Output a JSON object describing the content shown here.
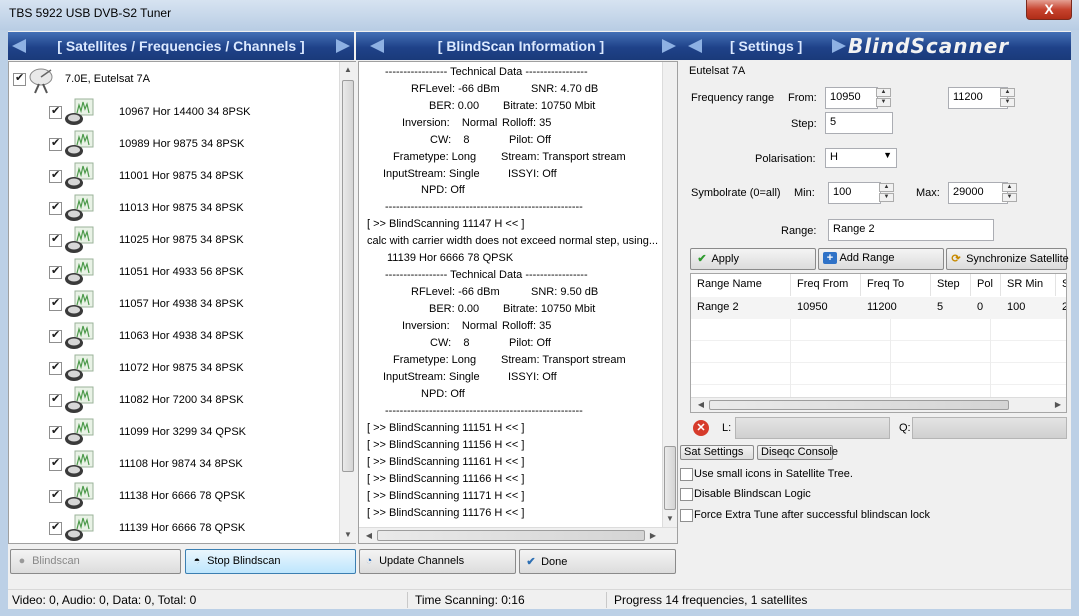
{
  "window": {
    "title": "TBS 5922 USB DVB-S2 Tuner",
    "close": "X"
  },
  "headers": {
    "satellites": "[ Satellites / Frequencies / Channels ]",
    "blindscan": "[ BlindScan Information ]",
    "settings": "[ Settings ]",
    "logo": "BlindScanner"
  },
  "tree": {
    "satellite": "7.0E, Eutelsat 7A",
    "items": [
      "10967 Hor 14400 34 8PSK",
      "10989 Hor 9875 34 8PSK",
      "11001 Hor 9875 34 8PSK",
      "11013 Hor 9875 34 8PSK",
      "11025 Hor 9875 34 8PSK",
      "11051 Hor 4933 56 8PSK",
      "11057 Hor 4938 34 8PSK",
      "11063 Hor 4938 34 8PSK",
      "11072 Hor 9875 34 8PSK",
      "11082 Hor 7200 34 8PSK",
      "11099 Hor 3299 34 QPSK",
      "11108 Hor 9874 34 8PSK",
      "11138 Hor 6666 78 QPSK",
      "11139 Hor 6666 78 QPSK"
    ]
  },
  "log": {
    "tech_header": "----------------- Technical Data -----------------",
    "block1": {
      "rflevel": "RFLevel: -66 dBm",
      "snr": "SNR: 4.70 dB",
      "ber": "BER: 0.00",
      "bitrate": "Bitrate: 10750 Mbit",
      "inversion": "Inversion:    Normal",
      "rolloff": "Rolloff: 35",
      "cw": "CW:    8",
      "pilot": "Pilot: Off",
      "frametype": "Frametype: Long",
      "stream": "Stream: Transport stream",
      "inputstream": "InputStream: Single",
      "issyi": "ISSYI: Off",
      "npd": "NPD: Off"
    },
    "separator": "------------------------------------------------------",
    "scan_11147": "[ >> BlindScanning 11147 H << ]",
    "calc_msg": "calc with carrier width does not exceed normal step, using...",
    "found": "11139 Hor 6666 78 QPSK",
    "block2": {
      "rflevel": "RFLevel: -66 dBm",
      "snr": "SNR: 9.50 dB",
      "ber": "BER: 0.00",
      "bitrate": "Bitrate: 10750 Mbit",
      "inversion": "Inversion:    Normal",
      "rolloff": "Rolloff: 35",
      "cw": "CW:    8",
      "pilot": "Pilot: Off",
      "frametype": "Frametype: Long",
      "stream": "Stream: Transport stream",
      "inputstream": "InputStream: Single",
      "issyi": "ISSYI: Off",
      "npd": "NPD: Off"
    },
    "scans": [
      "[ >> BlindScanning 11151 H << ]",
      "[ >> BlindScanning 11156 H << ]",
      "[ >> BlindScanning 11161 H << ]",
      "[ >> BlindScanning 11166 H << ]",
      "[ >> BlindScanning 11171 H << ]",
      "[ >> BlindScanning 11176 H << ]"
    ]
  },
  "settings": {
    "satellite_name": "Eutelsat 7A",
    "freq_range_label": "Frequency range",
    "from_label": "From:",
    "from_value": "10950",
    "to_value": "11200",
    "step_label": "Step:",
    "step_value": "5",
    "polarisation_label": "Polarisation:",
    "polarisation_value": "H",
    "symbolrate_label": "Symbolrate (0=all)",
    "min_label": "Min:",
    "min_value": "100",
    "max_label": "Max:",
    "max_value": "29000",
    "range_label": "Range:",
    "range_value": "Range 2",
    "apply": "Apply",
    "add_range": "Add Range",
    "sync_sat": "Synchronize Satellite",
    "grid": {
      "columns": [
        "Range Name",
        "Freq From",
        "Freq To",
        "Step",
        "Pol",
        "SR Min",
        "S"
      ],
      "rows": [
        [
          "Range 2",
          "10950",
          "11200",
          "5",
          "0",
          "100",
          "2"
        ]
      ]
    },
    "l_label": "L:",
    "q_label": "Q:",
    "sat_settings_tab": "Sat Settings",
    "diseqc_tab": "Diseqc Console",
    "opt_small_icons": "Use small icons in Satellite Tree.",
    "opt_disable_logic": "Disable Blindscan Logic",
    "opt_force_tune": "Force Extra Tune after successful blindscan lock"
  },
  "buttons": {
    "blindscan": "Blindscan",
    "stop_blindscan": "Stop Blindscan",
    "update_channels": "Update Channels",
    "done": "Done"
  },
  "status": {
    "counts": "Video: 0, Audio: 0, Data: 0, Total: 0",
    "time": "Time Scanning: 0:16",
    "progress": "Progress 14 frequencies, 1 satellites"
  }
}
